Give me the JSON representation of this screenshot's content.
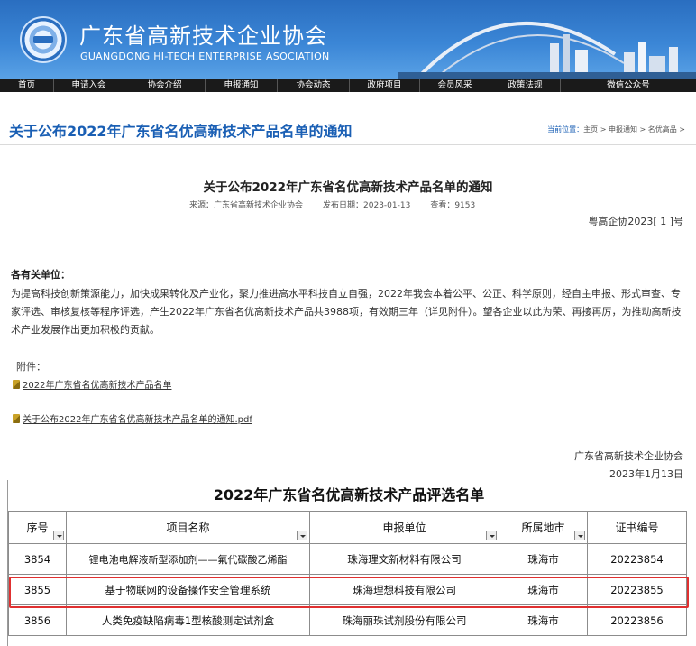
{
  "site": {
    "title_cn": "广东省高新技术企业协会",
    "title_en": "GUANGDONG HI-TECH ENTERPRISE ASOCIATION",
    "logo_icon": "association-logo-icon"
  },
  "nav": {
    "items": [
      "首页",
      "申请入会",
      "协会介绍",
      "申报通知",
      "协会动态",
      "政府项目",
      "会员风采",
      "政策法规",
      "微信公众号"
    ]
  },
  "page": {
    "title": "关于公布2022年广东省名优高新技术产品名单的通知",
    "breadcrumb": {
      "lead": "当前位置：",
      "path": "主页 > 申报通知 > 名优高品 >"
    }
  },
  "article": {
    "title": "关于公布2022年广东省名优高新技术产品名单的通知",
    "source": "来源：广东省高新技术企业协会",
    "date": "发布日期：2023-01-13",
    "views": "查看：9153",
    "doc_no": "粤高企协2023[ 1 ]号",
    "greeting": "各有关单位：",
    "body": "为提高科技创新策源能力，加快成果转化及产业化，聚力推进高水平科技自立自强，2022年我会本着公平、公正、科学原则，经自主申报、形式审查、专家评选、审核复核等程序评选，产生2022年广东省名优高新技术产品共3988项，有效期三年（详见附件）。望各企业以此为荣、再接再厉，为推动高新技术产业发展作出更加积极的贡献。",
    "attachments_label": "附件：",
    "attachments": [
      "2022年广东省名优高新技术产品名单",
      "关于公布2022年广东省名优高新技术产品名单的通知.pdf"
    ],
    "sign_org": "广东省高新技术企业协会",
    "sign_date": "2023年1月13日"
  },
  "sheet": {
    "title": "2022年广东省名优高新技术产品评选名单",
    "headers": [
      "序号",
      "项目名称",
      "申报单位",
      "所属地市",
      "证书编号"
    ],
    "rows": [
      [
        "3854",
        "锂电池电解液新型添加剂——氟代碳酸乙烯酯",
        "珠海理文新材料有限公司",
        "珠海市",
        "20223854"
      ],
      [
        "3855",
        "基于物联网的设备操作安全管理系统",
        "珠海理想科技有限公司",
        "珠海市",
        "20223855"
      ],
      [
        "3856",
        "人类免疫缺陷病毒1型核酸测定试剂盒",
        "珠海丽珠试剂股份有限公司",
        "珠海市",
        "20223856"
      ]
    ],
    "highlight_color": "#e03030"
  }
}
